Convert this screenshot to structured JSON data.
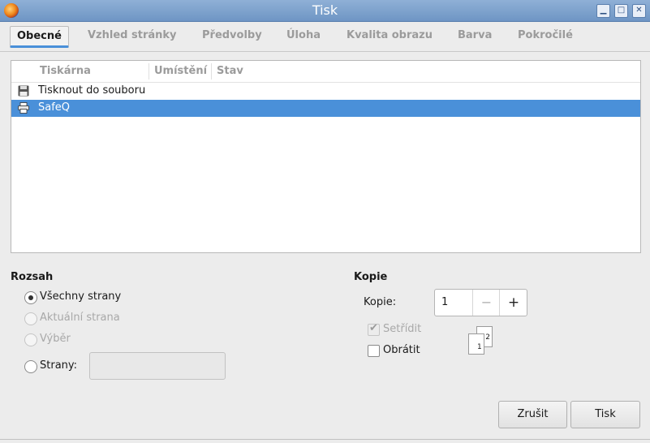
{
  "window": {
    "title": "Tisk"
  },
  "tabs": [
    {
      "label": "Obecné"
    },
    {
      "label": "Vzhled stránky"
    },
    {
      "label": "Předvolby"
    },
    {
      "label": "Úloha"
    },
    {
      "label": "Kvalita obrazu"
    },
    {
      "label": "Barva"
    },
    {
      "label": "Pokročilé"
    }
  ],
  "printers": {
    "columns": [
      "Tiskárna",
      "Umístění",
      "Stav"
    ],
    "rows": [
      {
        "name": "Tisknout do souboru",
        "icon": "floppy-disk-icon"
      },
      {
        "name": "SafeQ",
        "icon": "printer-icon"
      }
    ],
    "selected_index": 1
  },
  "range": {
    "title": "Rozsah",
    "options": [
      {
        "label": "Všechny strany",
        "checked": true,
        "enabled": true
      },
      {
        "label": "Aktuální strana",
        "checked": false,
        "enabled": false
      },
      {
        "label": "Výběr",
        "checked": false,
        "enabled": false
      },
      {
        "label": "Strany:",
        "checked": false,
        "enabled": true
      }
    ],
    "pages_value": ""
  },
  "copies": {
    "title": "Kopie",
    "copies_label": "Kopie:",
    "copies_value": "1",
    "minus_label": "−",
    "plus_label": "+",
    "collate_label": "Setřídit",
    "collate_checked": true,
    "collate_enabled": false,
    "reverse_label": "Obrátit",
    "reverse_checked": false,
    "page_preview": [
      "1",
      "2"
    ]
  },
  "buttons": {
    "cancel": "Zrušit",
    "print": "Tisk"
  },
  "colors": {
    "accent": "#4a90d9",
    "titlebar": "#7a9fcc"
  }
}
